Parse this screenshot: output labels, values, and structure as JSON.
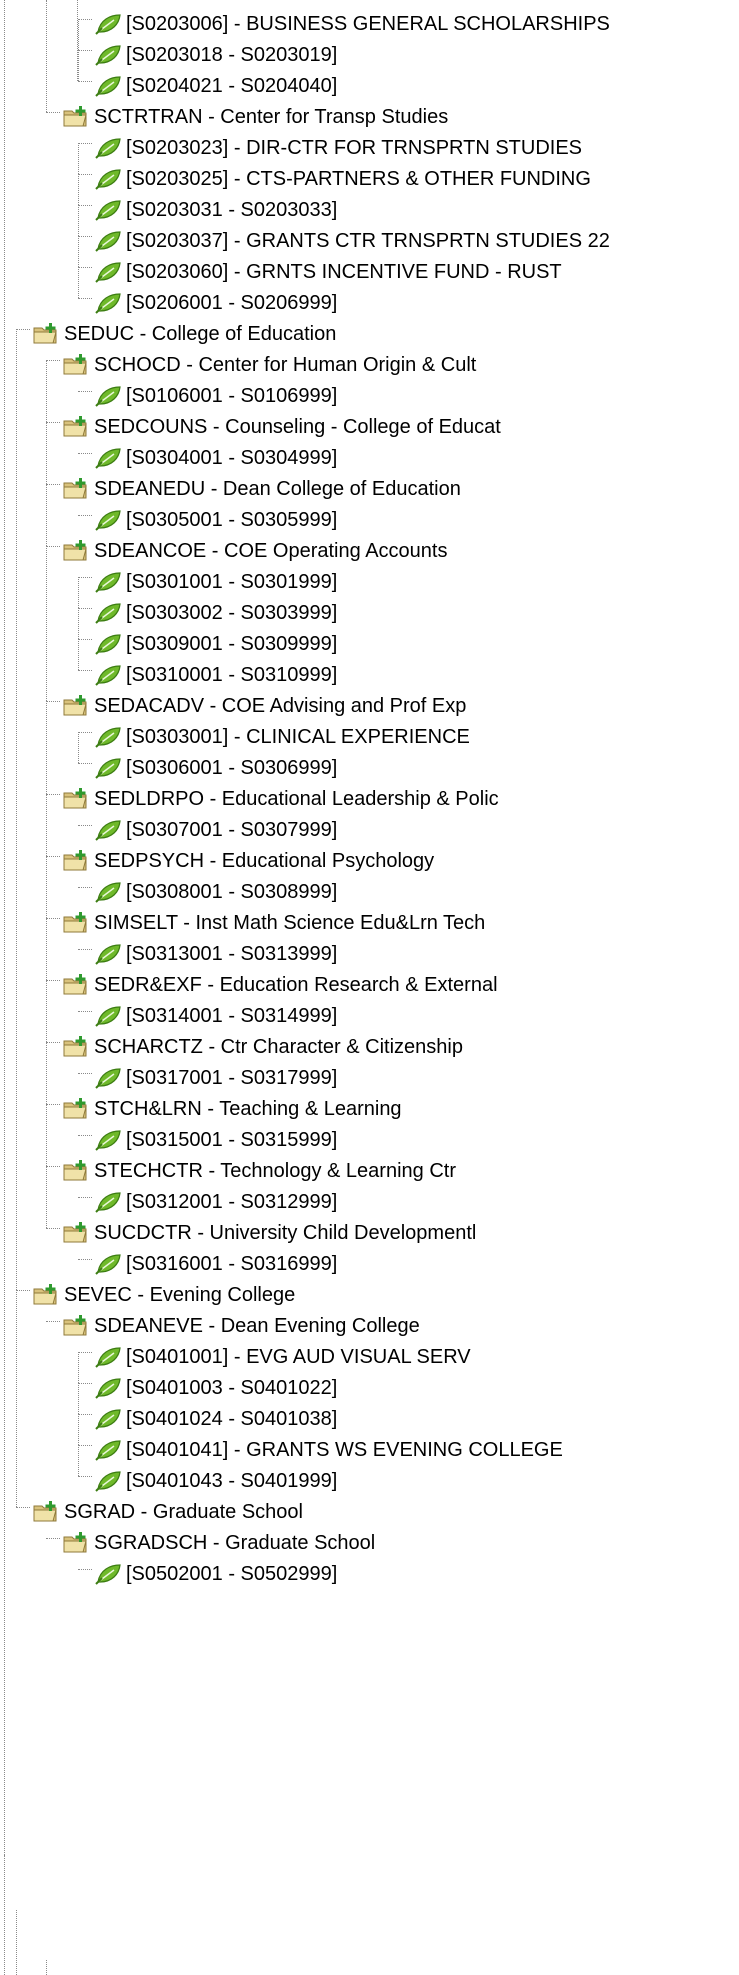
{
  "icons": {
    "folder": "folder-add-icon",
    "leaf": "leaf-icon"
  },
  "colors": {
    "leaf_green": "#6fb92a",
    "folder_tan": "#d9c27c",
    "folder_plus": "#2f9a2f"
  },
  "tree": {
    "nodes": [
      {
        "type": "leaf",
        "text": "[S0203006] - BUSINESS GENERAL SCHOLARSHIPS"
      },
      {
        "type": "leaf",
        "text": "[S0203018 - S0203019]"
      },
      {
        "type": "leaf",
        "text": "[S0204021 - S0204040]"
      },
      {
        "type": "folder",
        "text": "SCTRTRAN - Center for Transp Studies"
      },
      {
        "type": "leaf",
        "text": "[S0203023] - DIR-CTR FOR TRNSPRTN STUDIES"
      },
      {
        "type": "leaf",
        "text": "[S0203025] - CTS-PARTNERS & OTHER FUNDING"
      },
      {
        "type": "leaf",
        "text": "[S0203031 - S0203033]"
      },
      {
        "type": "leaf",
        "text": "[S0203037] - GRANTS CTR TRNSPRTN STUDIES 22"
      },
      {
        "type": "leaf",
        "text": "[S0203060] - GRNTS INCENTIVE FUND - RUST"
      },
      {
        "type": "leaf",
        "text": "[S0206001 - S0206999]"
      },
      {
        "type": "folder",
        "text": "SEDUC - College of Education"
      },
      {
        "type": "folder",
        "text": "SCHOCD - Center for Human Origin & Cult"
      },
      {
        "type": "leaf",
        "text": "[S0106001 - S0106999]"
      },
      {
        "type": "folder",
        "text": "SEDCOUNS - Counseling - College of Educat"
      },
      {
        "type": "leaf",
        "text": "[S0304001 - S0304999]"
      },
      {
        "type": "folder",
        "text": "SDEANEDU - Dean College of Education"
      },
      {
        "type": "leaf",
        "text": "[S0305001 - S0305999]"
      },
      {
        "type": "folder",
        "text": "SDEANCOE - COE Operating Accounts"
      },
      {
        "type": "leaf",
        "text": "[S0301001 - S0301999]"
      },
      {
        "type": "leaf",
        "text": "[S0303002 - S0303999]"
      },
      {
        "type": "leaf",
        "text": "[S0309001 - S0309999]"
      },
      {
        "type": "leaf",
        "text": "[S0310001 - S0310999]"
      },
      {
        "type": "folder",
        "text": "SEDACADV - COE Advising and Prof Exp"
      },
      {
        "type": "leaf",
        "text": "[S0303001] - CLINICAL EXPERIENCE"
      },
      {
        "type": "leaf",
        "text": "[S0306001 - S0306999]"
      },
      {
        "type": "folder",
        "text": "SEDLDRPO - Educational Leadership & Polic"
      },
      {
        "type": "leaf",
        "text": "[S0307001 - S0307999]"
      },
      {
        "type": "folder",
        "text": "SEDPSYCH - Educational Psychology"
      },
      {
        "type": "leaf",
        "text": "[S0308001 - S0308999]"
      },
      {
        "type": "folder",
        "text": "SIMSELT - Inst Math Science Edu&Lrn Tech"
      },
      {
        "type": "leaf",
        "text": "[S0313001 - S0313999]"
      },
      {
        "type": "folder",
        "text": "SEDR&EXF - Education Research & External"
      },
      {
        "type": "leaf",
        "text": "[S0314001 - S0314999]"
      },
      {
        "type": "folder",
        "text": "SCHARCTZ - Ctr Character & Citizenship"
      },
      {
        "type": "leaf",
        "text": "[S0317001 - S0317999]"
      },
      {
        "type": "folder",
        "text": "STCH&LRN - Teaching & Learning"
      },
      {
        "type": "leaf",
        "text": "[S0315001 - S0315999]"
      },
      {
        "type": "folder",
        "text": "STECHCTR - Technology & Learning Ctr"
      },
      {
        "type": "leaf",
        "text": "[S0312001 - S0312999]"
      },
      {
        "type": "folder",
        "text": "SUCDCTR - University Child Developmentl"
      },
      {
        "type": "leaf",
        "text": "[S0316001 - S0316999]"
      },
      {
        "type": "folder",
        "text": "SEVEC - Evening College"
      },
      {
        "type": "folder",
        "text": "SDEANEVE - Dean Evening College"
      },
      {
        "type": "leaf",
        "text": "[S0401001] - EVG AUD VISUAL SERV"
      },
      {
        "type": "leaf",
        "text": "[S0401003 - S0401022]"
      },
      {
        "type": "leaf",
        "text": "[S0401024 - S0401038]"
      },
      {
        "type": "leaf",
        "text": "[S0401041] - GRANTS WS EVENING COLLEGE"
      },
      {
        "type": "leaf",
        "text": "[S0401043 - S0401999]"
      },
      {
        "type": "folder",
        "text": "SGRAD - Graduate School"
      },
      {
        "type": "folder",
        "text": "SGRADSCH - Graduate School"
      },
      {
        "type": "leaf",
        "text": "[S0502001 - S0502999]"
      }
    ]
  }
}
